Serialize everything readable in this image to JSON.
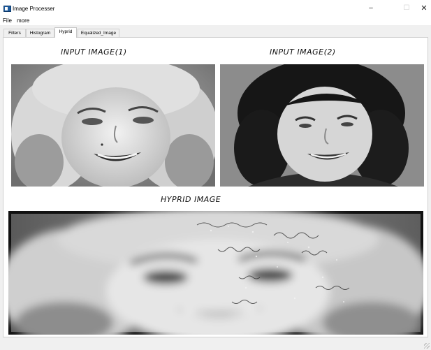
{
  "window": {
    "title": "Image Processer",
    "icon": "app-window-icon",
    "controls": {
      "minimize": "–",
      "maximize": "☐",
      "close": "✕"
    }
  },
  "menu": [
    {
      "label": "File"
    },
    {
      "label": "more"
    }
  ],
  "tabs": [
    {
      "label": "Filters",
      "active": false
    },
    {
      "label": "Histogram",
      "active": false
    },
    {
      "label": "Hyprid",
      "active": true
    },
    {
      "label": "Equalized_Image",
      "active": false
    }
  ],
  "hybrid_tab": {
    "input1_label": "INPUT IMAGE(1)",
    "input2_label": "INPUT IMAGE(2)",
    "output_label": "HYPRID IMAGE"
  }
}
